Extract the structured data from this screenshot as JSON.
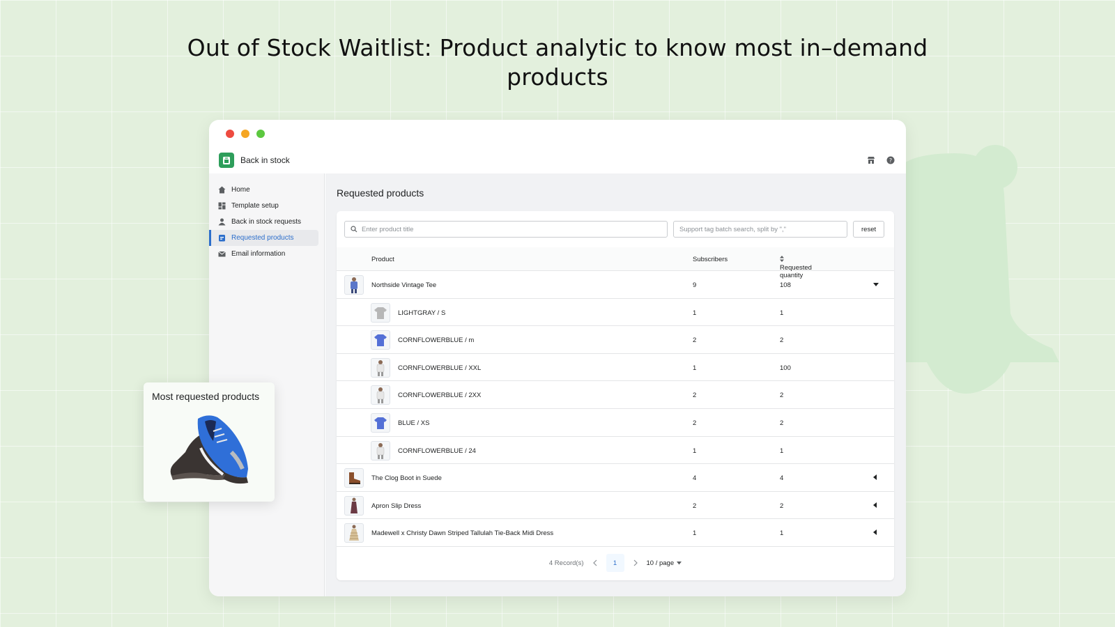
{
  "headline": "Out of Stock Waitlist: Product analytic to know most in–demand products",
  "colors": {
    "accent": "#2c6ecb",
    "brand_green": "#2e9e5b",
    "traffic_red": "#ee4b40",
    "traffic_yellow": "#f5a623",
    "traffic_green": "#5cc83f",
    "background": "#e3f0dd"
  },
  "app": {
    "name": "Back in stock",
    "logo_icon": "store-bag-icon",
    "top_icons": [
      "storefront-icon",
      "help-icon"
    ]
  },
  "sidebar": {
    "items": [
      {
        "label": "Home",
        "icon": "home-icon",
        "active": false
      },
      {
        "label": "Template setup",
        "icon": "template-icon",
        "active": false
      },
      {
        "label": "Back in stock requests",
        "icon": "user-icon",
        "active": false
      },
      {
        "label": "Requested products",
        "icon": "product-icon",
        "active": true
      },
      {
        "label": "Email information",
        "icon": "email-icon",
        "active": false
      }
    ]
  },
  "main": {
    "title": "Requested products",
    "search": {
      "product_placeholder": "Enter product title",
      "tag_placeholder": "Support tag batch search, split by \",\"",
      "reset_label": "reset"
    },
    "table": {
      "headers": {
        "product": "Product",
        "subscribers": "Subscribers",
        "requested_quantity": "Requested quantity"
      },
      "rows": [
        {
          "name": "Northside Vintage Tee",
          "subscribers": "9",
          "quantity": "108",
          "level": "product",
          "caret": "expanded",
          "thumb": "model-blue"
        },
        {
          "name": "LIGHTGRAY / S",
          "subscribers": "1",
          "quantity": "1",
          "level": "variant",
          "thumb": "tee-gray"
        },
        {
          "name": "CORNFLOWERBLUE / m",
          "subscribers": "2",
          "quantity": "2",
          "level": "variant",
          "thumb": "tee-blue"
        },
        {
          "name": "CORNFLOWERBLUE / XXL",
          "subscribers": "1",
          "quantity": "100",
          "level": "variant",
          "thumb": "model-white"
        },
        {
          "name": "CORNFLOWERBLUE / 2XX",
          "subscribers": "2",
          "quantity": "2",
          "level": "variant",
          "thumb": "model-white"
        },
        {
          "name": "BLUE / XS",
          "subscribers": "2",
          "quantity": "2",
          "level": "variant",
          "thumb": "tee-blue"
        },
        {
          "name": "CORNFLOWERBLUE / 24",
          "subscribers": "1",
          "quantity": "1",
          "level": "variant",
          "thumb": "model-white"
        },
        {
          "name": "The Clog Boot in Suede",
          "subscribers": "4",
          "quantity": "4",
          "level": "product",
          "caret": "collapsed",
          "thumb": "boot"
        },
        {
          "name": "Apron Slip Dress",
          "subscribers": "2",
          "quantity": "2",
          "level": "product",
          "caret": "collapsed",
          "thumb": "dress-dark"
        },
        {
          "name": "Madewell x Christy Dawn Striped Tallulah Tie-Back Midi Dress",
          "subscribers": "1",
          "quantity": "1",
          "level": "product",
          "caret": "collapsed",
          "thumb": "dress-beige"
        }
      ]
    },
    "pagination": {
      "records": "4 Record(s)",
      "current_page": "1",
      "per_page": "10 / page"
    }
  },
  "promo": {
    "title": "Most requested products",
    "image_icon": "sneaker-icon"
  }
}
